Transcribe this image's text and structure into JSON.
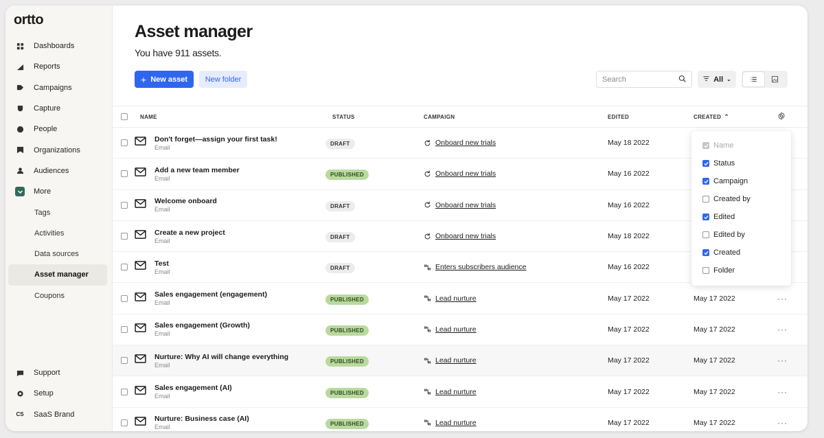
{
  "app": {
    "logo": "ortto"
  },
  "sidebar": {
    "items": [
      {
        "label": "Dashboards",
        "icon": "dashboard-icon"
      },
      {
        "label": "Reports",
        "icon": "chart-icon"
      },
      {
        "label": "Campaigns",
        "icon": "campaign-icon"
      },
      {
        "label": "Capture",
        "icon": "capture-icon"
      },
      {
        "label": "People",
        "icon": "person-icon"
      },
      {
        "label": "Organizations",
        "icon": "building-icon"
      },
      {
        "label": "Audiences",
        "icon": "audience-icon"
      },
      {
        "label": "More",
        "icon": "chevron-down-icon"
      }
    ],
    "sub_items": [
      {
        "label": "Tags"
      },
      {
        "label": "Activities"
      },
      {
        "label": "Data sources"
      },
      {
        "label": "Asset manager",
        "active": true
      },
      {
        "label": "Coupons"
      }
    ],
    "bottom": [
      {
        "label": "Support",
        "icon": "chat-icon"
      },
      {
        "label": "Setup",
        "icon": "gear-icon"
      },
      {
        "label": "SaaS Brand",
        "icon_text": "CS"
      }
    ]
  },
  "header": {
    "title": "Asset manager",
    "subtitle": "You have 911 assets.",
    "new_asset": "New asset",
    "new_folder": "New folder",
    "search_placeholder": "Search",
    "filter_label": "All"
  },
  "table": {
    "columns": {
      "name": "NAME",
      "status": "STATUS",
      "campaign": "CAMPAIGN",
      "edited": "EDITED",
      "created": "CREATED"
    },
    "rows": [
      {
        "name": "Don't forget—assign your first task!",
        "type": "Email",
        "status": "DRAFT",
        "campaign": "Onboard new trials",
        "campaign_icon": "refresh",
        "edited": "May 18 2022",
        "created": ""
      },
      {
        "name": "Add a new team member",
        "type": "Email",
        "status": "PUBLISHED",
        "campaign": "Onboard new trials",
        "campaign_icon": "refresh",
        "edited": "May 16 2022",
        "created": ""
      },
      {
        "name": "Welcome onboard",
        "type": "Email",
        "status": "DRAFT",
        "campaign": "Onboard new trials",
        "campaign_icon": "refresh",
        "edited": "May 16 2022",
        "created": ""
      },
      {
        "name": "Create a new project",
        "type": "Email",
        "status": "DRAFT",
        "campaign": "Onboard new trials",
        "campaign_icon": "refresh",
        "edited": "May 18 2022",
        "created": ""
      },
      {
        "name": "Test",
        "type": "Email",
        "status": "DRAFT",
        "campaign": "Enters subscribers audience",
        "campaign_icon": "journey",
        "edited": "May 16 2022",
        "created": ""
      },
      {
        "name": "Sales engagement (engagement)",
        "type": "Email",
        "status": "PUBLISHED",
        "campaign": "Lead nurture",
        "campaign_icon": "journey",
        "edited": "May 17 2022",
        "created": "May 17 2022"
      },
      {
        "name": "Sales engagement (Growth)",
        "type": "Email",
        "status": "PUBLISHED",
        "campaign": "Lead nurture",
        "campaign_icon": "journey",
        "edited": "May 17 2022",
        "created": "May 17 2022"
      },
      {
        "name": "Nurture: Why AI will change everything",
        "type": "Email",
        "status": "PUBLISHED",
        "campaign": "Lead nurture",
        "campaign_icon": "journey",
        "edited": "May 17 2022",
        "created": "May 17 2022",
        "hover": true
      },
      {
        "name": "Sales engagement (AI)",
        "type": "Email",
        "status": "PUBLISHED",
        "campaign": "Lead nurture",
        "campaign_icon": "journey",
        "edited": "May 17 2022",
        "created": "May 17 2022"
      },
      {
        "name": "Nurture: Business case (AI)",
        "type": "Email",
        "status": "PUBLISHED",
        "campaign": "Lead nurture",
        "campaign_icon": "journey",
        "edited": "May 17 2022",
        "created": "May 17 2022"
      }
    ],
    "more_label": "···"
  },
  "column_menu": {
    "options": [
      {
        "label": "Name",
        "checked": true,
        "disabled": true
      },
      {
        "label": "Status",
        "checked": true
      },
      {
        "label": "Campaign",
        "checked": true
      },
      {
        "label": "Created by",
        "checked": false
      },
      {
        "label": "Edited",
        "checked": true
      },
      {
        "label": "Edited by",
        "checked": false
      },
      {
        "label": "Created",
        "checked": true
      },
      {
        "label": "Folder",
        "checked": false
      }
    ]
  },
  "colors": {
    "accent": "#2f66f0",
    "more_icon_bg": "#2f6b5c",
    "published": "#b9d99e",
    "draft": "#ececec"
  }
}
